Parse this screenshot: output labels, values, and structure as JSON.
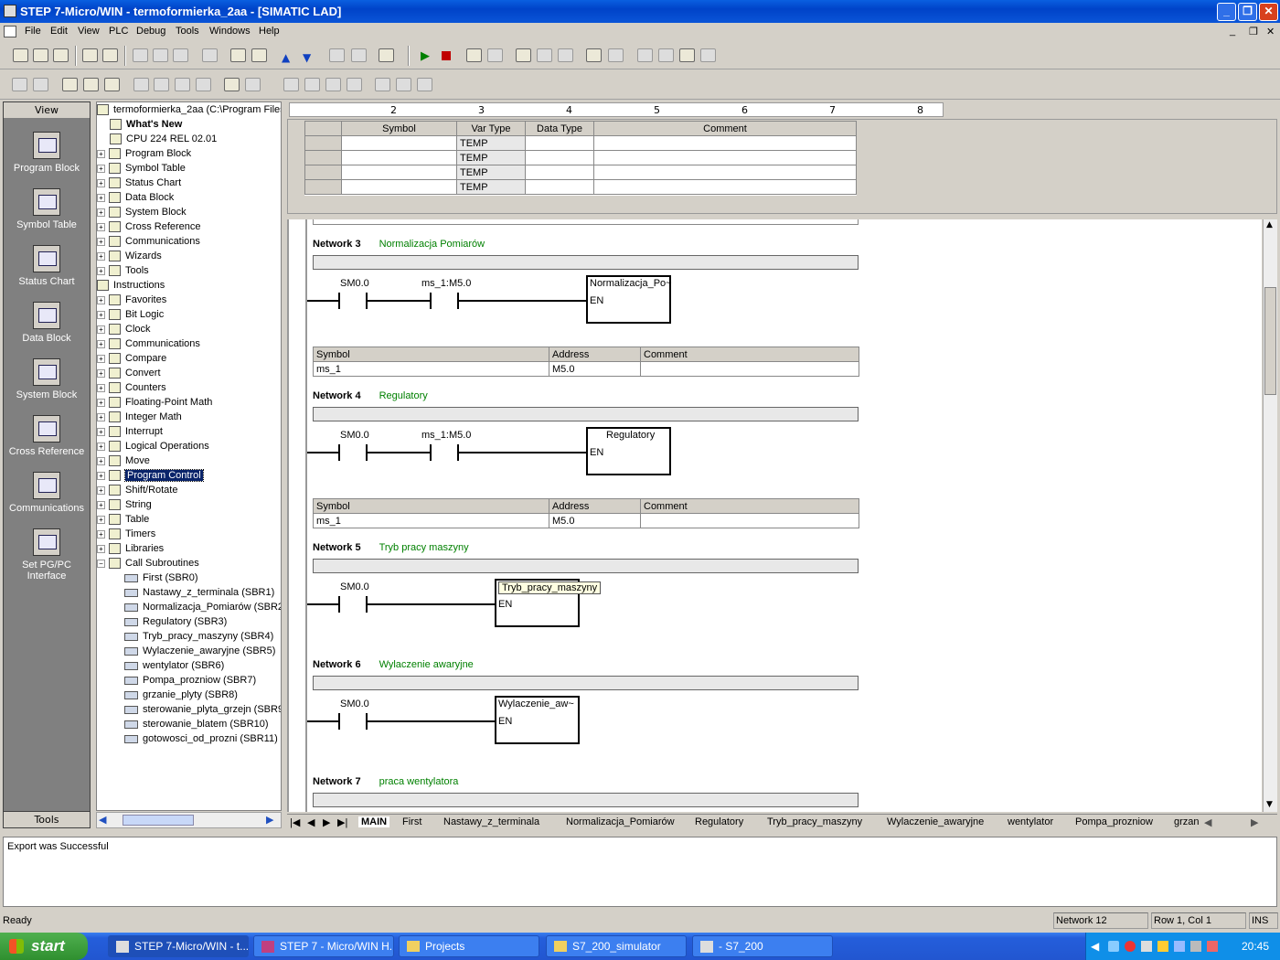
{
  "window": {
    "title": "STEP 7-Micro/WIN - termoformierka_2aa - [SIMATIC LAD]"
  },
  "menu": [
    "File",
    "Edit",
    "View",
    "PLC",
    "Debug",
    "Tools",
    "Windows",
    "Help"
  ],
  "viewbar": {
    "header": "View",
    "items": [
      "Program Block",
      "Symbol Table",
      "Status Chart",
      "Data Block",
      "System Block",
      "Cross Reference",
      "Communications",
      "Set PG/PC Interface"
    ],
    "footer": "Tools"
  },
  "tree": {
    "root": "termoformierka_2aa (C:\\Program Files\\S",
    "items": [
      "What's New",
      "CPU 224 REL 02.01",
      "Program Block",
      "Symbol Table",
      "Status Chart",
      "Data Block",
      "System Block",
      "Cross Reference",
      "Communications",
      "Wizards",
      "Tools"
    ],
    "instructions_label": "Instructions",
    "instructions": [
      "Favorites",
      "Bit Logic",
      "Clock",
      "Communications",
      "Compare",
      "Convert",
      "Counters",
      "Floating-Point Math",
      "Integer Math",
      "Interrupt",
      "Logical Operations",
      "Move",
      "Program Control",
      "Shift/Rotate",
      "String",
      "Table",
      "Timers",
      "Libraries",
      "Call Subroutines"
    ],
    "subroutines": [
      "First (SBR0)",
      "Nastawy_z_terminala (SBR1)",
      "Normalizacja_Pomiarów (SBR2",
      "Regulatory (SBR3)",
      "Tryb_pracy_maszyny (SBR4)",
      "Wylaczenie_awaryjne (SBR5)",
      "wentylator (SBR6)",
      "Pompa_prozniow (SBR7)",
      "grzanie_plyty (SBR8)",
      "sterowanie_plyta_grzejn (SBR9",
      "sterowanie_blatem (SBR10)",
      "gotowosci_od_prozni (SBR11)"
    ]
  },
  "ruler": [
    "2",
    "3",
    "4",
    "5",
    "6",
    "7",
    "8"
  ],
  "vartable": {
    "headers": [
      "Symbol",
      "Var Type",
      "Data Type",
      "Comment"
    ],
    "rows": [
      "TEMP",
      "TEMP",
      "TEMP",
      "TEMP"
    ]
  },
  "networks": [
    {
      "label": "Network 3",
      "comment": "Normalizacja Pomiarów",
      "contact1": "SM0.0",
      "contact2": "ms_1:M5.0",
      "box": "Normalizacja_Po~",
      "en": "EN",
      "symtable": {
        "headers": [
          "Symbol",
          "Address",
          "Comment"
        ],
        "row": [
          "ms_1",
          "M5.0",
          ""
        ]
      }
    },
    {
      "label": "Network 4",
      "comment": "Regulatory",
      "contact1": "SM0.0",
      "contact2": "ms_1:M5.0",
      "box": "Regulatory",
      "en": "EN",
      "symtable": {
        "headers": [
          "Symbol",
          "Address",
          "Comment"
        ],
        "row": [
          "ms_1",
          "M5.0",
          ""
        ]
      }
    },
    {
      "label": "Network 5",
      "comment": "Tryb pracy maszyny",
      "contact1": "SM0.0",
      "box": "Tryb_pracy_maszyny",
      "en": "EN"
    },
    {
      "label": "Network 6",
      "comment": "Wylaczenie awaryjne",
      "contact1": "SM0.0",
      "box": "Wylaczenie_aw~",
      "en": "EN"
    },
    {
      "label": "Network 7",
      "comment": "praca wentylatora"
    }
  ],
  "tabs": [
    "MAIN",
    "First",
    "Nastawy_z_terminala",
    "Normalizacja_Pomiarów",
    "Regulatory",
    "Tryb_pracy_maszyny",
    "Wylaczenie_awaryjne",
    "wentylator",
    "Pompa_prozniow",
    "grzan"
  ],
  "output": "Export was Successful",
  "status": {
    "ready": "Ready",
    "network": "Network 12",
    "position": "Row 1, Col 1",
    "mode": "INS"
  },
  "taskbar": {
    "start": "start",
    "tasks": [
      "STEP 7-Micro/WIN - t...",
      "STEP 7 - Micro/WIN H...",
      "Projects",
      "S7_200_simulator",
      "- S7_200"
    ],
    "clock": "20:45"
  }
}
